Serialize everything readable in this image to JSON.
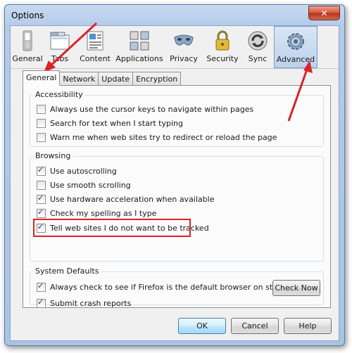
{
  "window": {
    "title": "Options",
    "close_glyph": "✕"
  },
  "toolbar": {
    "panes": [
      {
        "label": "General",
        "icon": "general-switch-icon"
      },
      {
        "label": "Tabs",
        "icon": "tabs-window-icon"
      },
      {
        "label": "Content",
        "icon": "content-page-icon"
      },
      {
        "label": "Applications",
        "icon": "applications-icon"
      },
      {
        "label": "Privacy",
        "icon": "privacy-mask-icon"
      },
      {
        "label": "Security",
        "icon": "security-lock-icon"
      },
      {
        "label": "Sync",
        "icon": "sync-icon"
      },
      {
        "label": "Advanced",
        "icon": "advanced-gear-icon",
        "selected": true
      }
    ]
  },
  "tabs": [
    "General",
    "Network",
    "Update",
    "Encryption"
  ],
  "groups": {
    "accessibility": {
      "label": "Accessibility",
      "items": [
        {
          "label": "Always use the cursor keys to navigate within pages",
          "checked": false
        },
        {
          "label": "Search for text when I start typing",
          "checked": false
        },
        {
          "label": "Warn me when web sites try to redirect or reload the page",
          "checked": false
        }
      ]
    },
    "browsing": {
      "label": "Browsing",
      "items": [
        {
          "label": "Use autoscrolling",
          "checked": true
        },
        {
          "label": "Use smooth scrolling",
          "checked": false
        },
        {
          "label": "Use hardware acceleration when available",
          "checked": true
        },
        {
          "label": "Check my spelling as I type",
          "checked": true
        },
        {
          "label": "Tell web sites I do not want to be tracked",
          "checked": true
        }
      ]
    },
    "system_defaults": {
      "label": "System Defaults",
      "items": [
        {
          "label": "Always check to see if Firefox is the default browser on startup",
          "checked": true
        },
        {
          "label": "Submit crash reports",
          "checked": true
        }
      ],
      "check_now_label": "Check Now"
    }
  },
  "buttons": {
    "ok": "OK",
    "cancel": "Cancel",
    "help": "Help"
  },
  "colors": {
    "annotation_red": "#d9232a",
    "selected_pane": "#bcd1ec"
  }
}
